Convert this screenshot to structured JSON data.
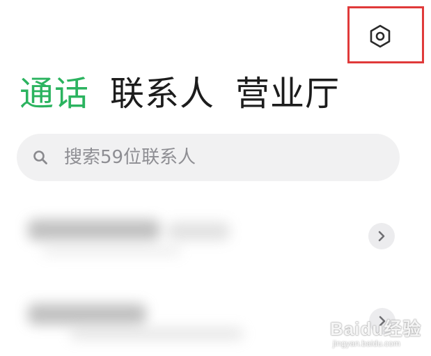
{
  "header": {
    "settings_icon": "settings-hexagon-icon"
  },
  "tabs": [
    {
      "label": "通话",
      "active": true
    },
    {
      "label": "联系人",
      "active": false
    },
    {
      "label": "营业厅",
      "active": false
    }
  ],
  "search": {
    "icon": "search-icon",
    "placeholder": "搜索59位联系人",
    "value": ""
  },
  "contacts": [
    {
      "blurred": true,
      "action_icon": "chevron-right-icon"
    },
    {
      "blurred": true,
      "action_icon": "chevron-right-icon"
    }
  ],
  "watermark": {
    "logo": "Baidu经验",
    "url": "jingyan.baidu.com"
  },
  "colors": {
    "accent": "#2bb35f",
    "highlight": "#e03a3a",
    "search_bg": "#f1f1f2"
  }
}
